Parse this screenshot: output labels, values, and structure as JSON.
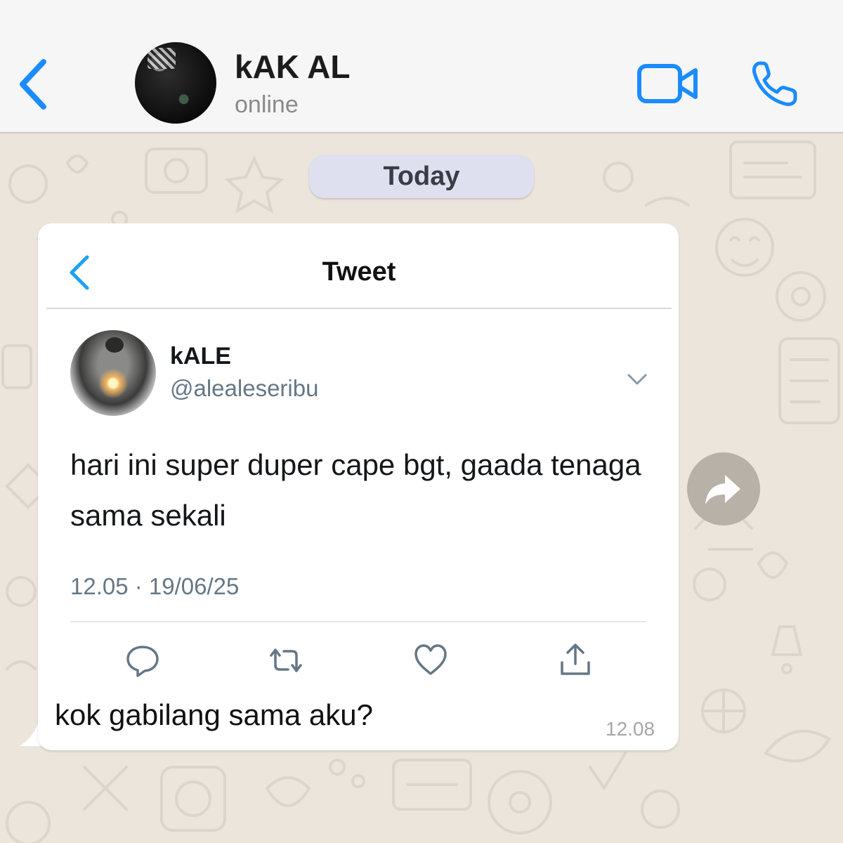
{
  "header": {
    "contact_name": "kAK AL",
    "status": "online",
    "accent_color": "#1a8cff",
    "icons": {
      "back": "chevron-left-icon",
      "video": "video-camera-icon",
      "phone": "phone-icon"
    }
  },
  "chat": {
    "date_label": "Today",
    "message": {
      "tweet": {
        "nav_title": "Tweet",
        "author_name": "kALE",
        "author_handle": "@aleale­seribu",
        "text": "hari ini super duper cape bgt, gaada tenaga sama sekali",
        "meta": "12.05 · 19/06/25",
        "actions": [
          "reply-icon",
          "retweet-icon",
          "like-icon",
          "share-icon"
        ]
      },
      "text": "kok gabilang sama aku?",
      "time": "12.08"
    },
    "forward_icon": "forward-arrow-icon"
  }
}
